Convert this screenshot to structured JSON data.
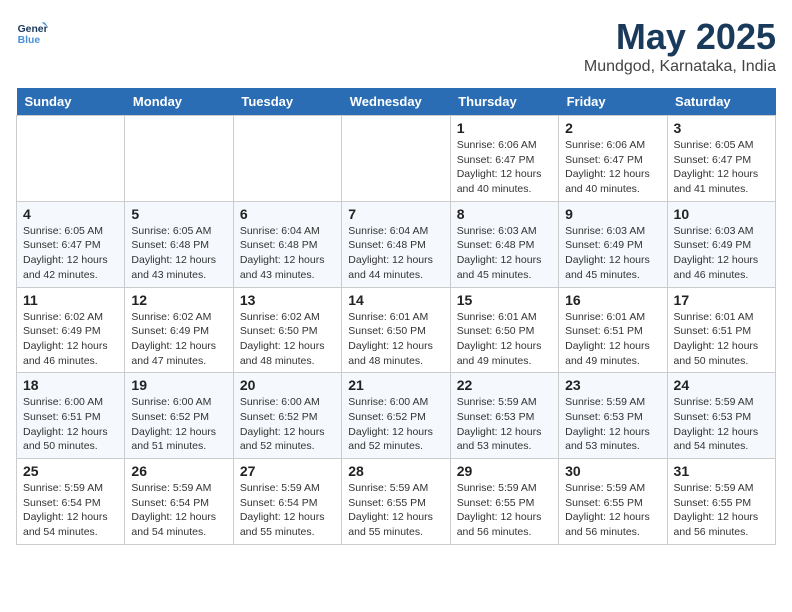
{
  "logo": {
    "line1": "General",
    "line2": "Blue"
  },
  "title": "May 2025",
  "subtitle": "Mundgod, Karnataka, India",
  "headers": [
    "Sunday",
    "Monday",
    "Tuesday",
    "Wednesday",
    "Thursday",
    "Friday",
    "Saturday"
  ],
  "weeks": [
    [
      {
        "day": "",
        "info": ""
      },
      {
        "day": "",
        "info": ""
      },
      {
        "day": "",
        "info": ""
      },
      {
        "day": "",
        "info": ""
      },
      {
        "day": "1",
        "info": "Sunrise: 6:06 AM\nSunset: 6:47 PM\nDaylight: 12 hours\nand 40 minutes."
      },
      {
        "day": "2",
        "info": "Sunrise: 6:06 AM\nSunset: 6:47 PM\nDaylight: 12 hours\nand 40 minutes."
      },
      {
        "day": "3",
        "info": "Sunrise: 6:05 AM\nSunset: 6:47 PM\nDaylight: 12 hours\nand 41 minutes."
      }
    ],
    [
      {
        "day": "4",
        "info": "Sunrise: 6:05 AM\nSunset: 6:47 PM\nDaylight: 12 hours\nand 42 minutes."
      },
      {
        "day": "5",
        "info": "Sunrise: 6:05 AM\nSunset: 6:48 PM\nDaylight: 12 hours\nand 43 minutes."
      },
      {
        "day": "6",
        "info": "Sunrise: 6:04 AM\nSunset: 6:48 PM\nDaylight: 12 hours\nand 43 minutes."
      },
      {
        "day": "7",
        "info": "Sunrise: 6:04 AM\nSunset: 6:48 PM\nDaylight: 12 hours\nand 44 minutes."
      },
      {
        "day": "8",
        "info": "Sunrise: 6:03 AM\nSunset: 6:48 PM\nDaylight: 12 hours\nand 45 minutes."
      },
      {
        "day": "9",
        "info": "Sunrise: 6:03 AM\nSunset: 6:49 PM\nDaylight: 12 hours\nand 45 minutes."
      },
      {
        "day": "10",
        "info": "Sunrise: 6:03 AM\nSunset: 6:49 PM\nDaylight: 12 hours\nand 46 minutes."
      }
    ],
    [
      {
        "day": "11",
        "info": "Sunrise: 6:02 AM\nSunset: 6:49 PM\nDaylight: 12 hours\nand 46 minutes."
      },
      {
        "day": "12",
        "info": "Sunrise: 6:02 AM\nSunset: 6:49 PM\nDaylight: 12 hours\nand 47 minutes."
      },
      {
        "day": "13",
        "info": "Sunrise: 6:02 AM\nSunset: 6:50 PM\nDaylight: 12 hours\nand 48 minutes."
      },
      {
        "day": "14",
        "info": "Sunrise: 6:01 AM\nSunset: 6:50 PM\nDaylight: 12 hours\nand 48 minutes."
      },
      {
        "day": "15",
        "info": "Sunrise: 6:01 AM\nSunset: 6:50 PM\nDaylight: 12 hours\nand 49 minutes."
      },
      {
        "day": "16",
        "info": "Sunrise: 6:01 AM\nSunset: 6:51 PM\nDaylight: 12 hours\nand 49 minutes."
      },
      {
        "day": "17",
        "info": "Sunrise: 6:01 AM\nSunset: 6:51 PM\nDaylight: 12 hours\nand 50 minutes."
      }
    ],
    [
      {
        "day": "18",
        "info": "Sunrise: 6:00 AM\nSunset: 6:51 PM\nDaylight: 12 hours\nand 50 minutes."
      },
      {
        "day": "19",
        "info": "Sunrise: 6:00 AM\nSunset: 6:52 PM\nDaylight: 12 hours\nand 51 minutes."
      },
      {
        "day": "20",
        "info": "Sunrise: 6:00 AM\nSunset: 6:52 PM\nDaylight: 12 hours\nand 52 minutes."
      },
      {
        "day": "21",
        "info": "Sunrise: 6:00 AM\nSunset: 6:52 PM\nDaylight: 12 hours\nand 52 minutes."
      },
      {
        "day": "22",
        "info": "Sunrise: 5:59 AM\nSunset: 6:53 PM\nDaylight: 12 hours\nand 53 minutes."
      },
      {
        "day": "23",
        "info": "Sunrise: 5:59 AM\nSunset: 6:53 PM\nDaylight: 12 hours\nand 53 minutes."
      },
      {
        "day": "24",
        "info": "Sunrise: 5:59 AM\nSunset: 6:53 PM\nDaylight: 12 hours\nand 54 minutes."
      }
    ],
    [
      {
        "day": "25",
        "info": "Sunrise: 5:59 AM\nSunset: 6:54 PM\nDaylight: 12 hours\nand 54 minutes."
      },
      {
        "day": "26",
        "info": "Sunrise: 5:59 AM\nSunset: 6:54 PM\nDaylight: 12 hours\nand 54 minutes."
      },
      {
        "day": "27",
        "info": "Sunrise: 5:59 AM\nSunset: 6:54 PM\nDaylight: 12 hours\nand 55 minutes."
      },
      {
        "day": "28",
        "info": "Sunrise: 5:59 AM\nSunset: 6:55 PM\nDaylight: 12 hours\nand 55 minutes."
      },
      {
        "day": "29",
        "info": "Sunrise: 5:59 AM\nSunset: 6:55 PM\nDaylight: 12 hours\nand 56 minutes."
      },
      {
        "day": "30",
        "info": "Sunrise: 5:59 AM\nSunset: 6:55 PM\nDaylight: 12 hours\nand 56 minutes."
      },
      {
        "day": "31",
        "info": "Sunrise: 5:59 AM\nSunset: 6:55 PM\nDaylight: 12 hours\nand 56 minutes."
      }
    ]
  ]
}
